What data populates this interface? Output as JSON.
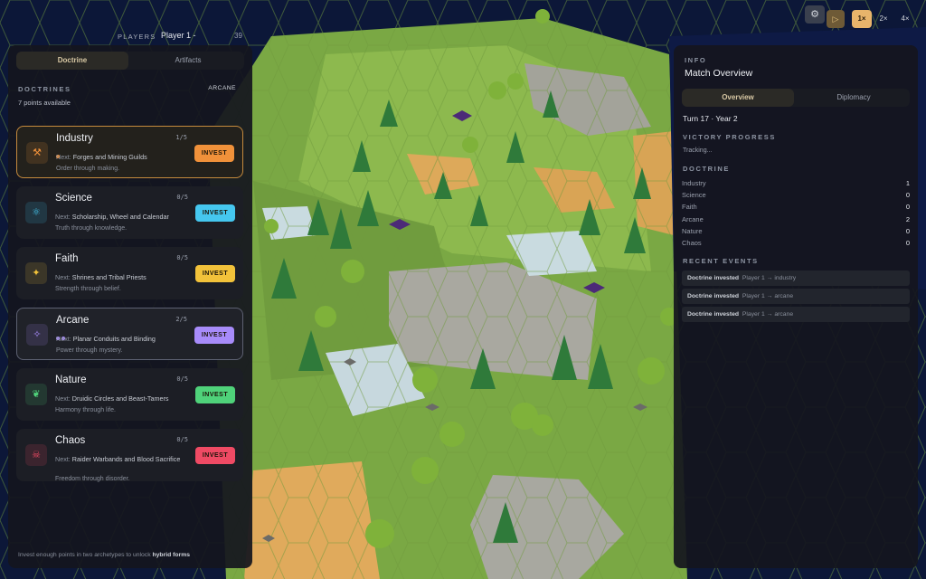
{
  "top_bar": {
    "players_label": "PLAYERS",
    "player_name": "Player 1",
    "count": "39"
  },
  "sim_controls": {
    "speeds": [
      "1×",
      "2×",
      "4×"
    ],
    "active_speed": "1×"
  },
  "left": {
    "tabs": [
      "Doctrine",
      "Artifacts"
    ],
    "active_tab": "Doctrine",
    "section_title": "DOCTRINES",
    "points": "7 points available",
    "focus": "ARCANE",
    "footer_pre": "Invest enough points in two archetypes to unlock ",
    "footer_bold": "hybrid forms",
    "doctrines": [
      {
        "name": "Industry",
        "count": "1/5",
        "next_label": "Next:",
        "next": "Forges and Mining Guilds",
        "flavor": "Order through making.",
        "button": "INVEST",
        "icon": "hammer-icon",
        "glyph": "⚒",
        "color": "#f0913a",
        "dots": 1,
        "selected": true
      },
      {
        "name": "Science",
        "count": "0/5",
        "next_label": "Next:",
        "next": "Scholarship, Wheel and Calendar",
        "flavor": "Truth through knowledge.",
        "button": "INVEST",
        "icon": "atom-icon",
        "glyph": "⚛",
        "color": "#45c7ef",
        "dots": 0,
        "selected": false
      },
      {
        "name": "Faith",
        "count": "0/5",
        "next_label": "Next:",
        "next": "Shrines and Tribal Priests",
        "flavor": "Strength through belief.",
        "button": "INVEST",
        "icon": "sparkle-icon",
        "glyph": "✦",
        "color": "#f2c23a",
        "dots": 0,
        "selected": false
      },
      {
        "name": "Arcane",
        "count": "2/5",
        "next_label": "Next:",
        "next": "Planar Conduits and Binding",
        "flavor": "Power through mystery.",
        "button": "INVEST",
        "icon": "wand-icon",
        "glyph": "✧",
        "color": "#a78bfa",
        "dots": 2,
        "selected": true
      },
      {
        "name": "Nature",
        "count": "0/5",
        "next_label": "Next:",
        "next": "Druidic Circles and Beast-Tamers",
        "flavor": "Harmony through life.",
        "button": "INVEST",
        "icon": "leaf-icon",
        "glyph": "❦",
        "color": "#4fd27a",
        "dots": 0,
        "selected": false
      },
      {
        "name": "Chaos",
        "count": "0/5",
        "next_label": "Next:",
        "next": "Raider Warbands and Blood Sacrifice",
        "flavor": "Freedom through disorder.",
        "button": "INVEST",
        "icon": "skull-icon",
        "glyph": "☠",
        "color": "#ef4a64",
        "dots": 0,
        "selected": false
      }
    ]
  },
  "right": {
    "caption": "INFO",
    "title": "Match Overview",
    "tabs": [
      "Overview",
      "Diplomacy"
    ],
    "active_tab": "Overview",
    "turn": "Turn 17 · Year 2",
    "victory_title": "VICTORY PROGRESS",
    "victory_status": "Tracking...",
    "doctrine_title": "DOCTRINE",
    "doctrine_levels": [
      {
        "name": "Industry",
        "value": "1"
      },
      {
        "name": "Science",
        "value": "0"
      },
      {
        "name": "Faith",
        "value": "0"
      },
      {
        "name": "Arcane",
        "value": "2"
      },
      {
        "name": "Nature",
        "value": "0"
      },
      {
        "name": "Chaos",
        "value": "0"
      }
    ],
    "events_title": "RECENT EVENTS",
    "events": [
      {
        "action": "Doctrine invested",
        "detail": "Player 1 → industry"
      },
      {
        "action": "Doctrine invested",
        "detail": "Player 1 → arcane"
      },
      {
        "action": "Doctrine invested",
        "detail": "Player 1 → arcane"
      }
    ]
  }
}
